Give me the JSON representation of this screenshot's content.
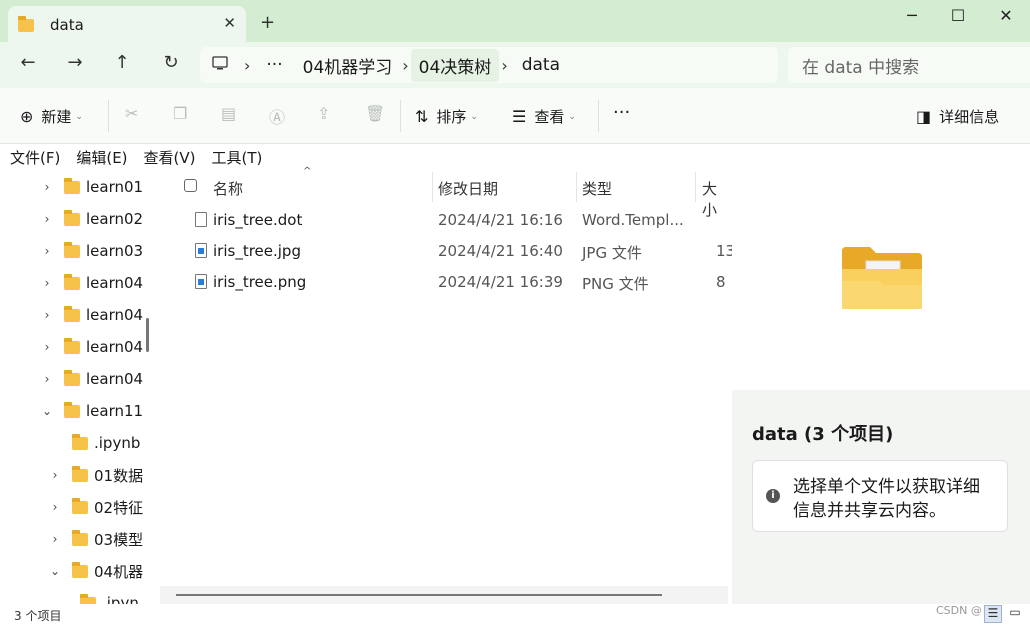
{
  "window": {
    "tab_title": "data",
    "tab_close": "✕",
    "new_tab": "+",
    "minimize": "─",
    "maximize": "☐",
    "close": "✕"
  },
  "nav": {
    "back": "←",
    "forward": "→",
    "up": "↑",
    "refresh": "↻"
  },
  "address": {
    "crumbs": [
      "04机器学习",
      "04决策树",
      "data"
    ],
    "more": "···",
    "computer_icon": "computer-icon"
  },
  "search": {
    "placeholder": "在 data 中搜索"
  },
  "commands": {
    "new": "新建",
    "sort": "排序",
    "view": "查看",
    "more": "···",
    "details": "详细信息"
  },
  "menu": [
    "文件(F)",
    "编辑(E)",
    "查看(V)",
    "工具(T)"
  ],
  "tree": [
    {
      "label": "learn01",
      "chevron": "›",
      "indent": 0
    },
    {
      "label": "learn02",
      "chevron": "›",
      "indent": 0
    },
    {
      "label": "learn03",
      "chevron": "›",
      "indent": 0
    },
    {
      "label": "learn04",
      "chevron": "›",
      "indent": 0
    },
    {
      "label": "learn04",
      "chevron": "›",
      "indent": 0
    },
    {
      "label": "learn04",
      "chevron": "›",
      "indent": 0
    },
    {
      "label": "learn04",
      "chevron": "›",
      "indent": 0
    },
    {
      "label": "learn11",
      "chevron": "⌄",
      "indent": 0
    },
    {
      "label": ".ipynb",
      "chevron": "",
      "indent": 1
    },
    {
      "label": "01数据",
      "chevron": "›",
      "indent": 1
    },
    {
      "label": "02特征",
      "chevron": "›",
      "indent": 1
    },
    {
      "label": "03模型",
      "chevron": "›",
      "indent": 1
    },
    {
      "label": "04机器",
      "chevron": "⌄",
      "indent": 1
    },
    {
      "label": ".ipyn",
      "chevron": "",
      "indent": 2
    }
  ],
  "columns": {
    "name": "名称",
    "modified": "修改日期",
    "type": "类型",
    "size": "大小"
  },
  "files": [
    {
      "name": "iris_tree.dot",
      "modified": "2024/4/21 16:16",
      "type": "Word.Templ...",
      "size": "",
      "icon": "document-icon"
    },
    {
      "name": "iris_tree.jpg",
      "modified": "2024/4/21 16:40",
      "type": "JPG 文件",
      "size": "13",
      "icon": "image-icon"
    },
    {
      "name": "iris_tree.png",
      "modified": "2024/4/21 16:39",
      "type": "PNG 文件",
      "size": "8",
      "icon": "image-icon"
    }
  ],
  "details": {
    "title": "data (3 个项目)",
    "info": "选择单个文件以获取详细信息并共享云内容。"
  },
  "status": {
    "count": "3 个项目",
    "watermark": "CSDN @"
  },
  "colors": {
    "titlebar": "#d4ecd2",
    "tab": "#eef7ed",
    "folder": "#f6c24a",
    "file_icon_accent": "#2b7bd8"
  }
}
